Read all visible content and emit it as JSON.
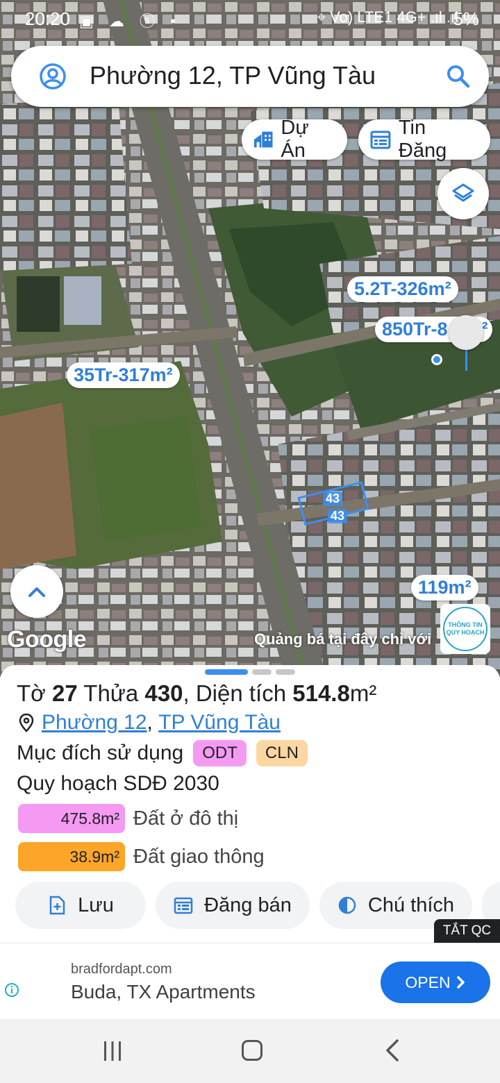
{
  "status_bar": {
    "time": "20:20",
    "left_icons": "▣ ☁ ⓢ •",
    "right_icons": "⌖ Vo) LTE1 4G+ .ıl .ıl",
    "battery": "5%"
  },
  "search": {
    "query": "Phường 12, TP Vũng Tàu"
  },
  "chips": {
    "project": "Dự Án",
    "listings": "Tin Đăng"
  },
  "map_labels": {
    "price_1": "5.2T-326m²",
    "price_2": "850Tr-8",
    "price_2_tail": "m²",
    "price_3": "35Tr-317m²",
    "price_4": "119m²",
    "parcel_label_top": "43",
    "parcel_label_bottom": "43",
    "google": "Google",
    "ad_text": "Quảng bá tại đây chỉ với",
    "qh_badge": "THÔNG TIN QUY HOẠCH"
  },
  "sheet": {
    "title": {
      "sheet_label": "Tờ",
      "sheet_no": "27",
      "plot_label": "Thửa",
      "plot_no": "430",
      "area_label": ", Diện tích",
      "area_value": "514.8",
      "area_unit": "m²"
    },
    "address": {
      "ward": "Phường 12",
      "sep": ",",
      "city": "TP Vũng Tàu"
    },
    "purpose_label": "Mục đích sử dụng",
    "purpose_tags": [
      "ODT",
      "CLN"
    ],
    "plan_label": "Quy hoạch SDĐ 2030",
    "plan_items": [
      {
        "area": "475.8m²",
        "label": "Đất ở đô thị",
        "color": "#f49af2"
      },
      {
        "area": "38.9m²",
        "label": "Đất giao thông",
        "color": "#fba629"
      }
    ],
    "actions": {
      "save": "Lưu",
      "post_sale": "Đăng bán",
      "legend": "Chú thích"
    }
  },
  "ad": {
    "hide_ads": "TẮT QC",
    "domain": "bradfordapt.com",
    "headline": "Buda, TX Apartments",
    "cta": "OPEN"
  },
  "colors": {
    "accent": "#3b8ef0",
    "link": "#2f7fd8",
    "cta": "#1a73e8"
  }
}
